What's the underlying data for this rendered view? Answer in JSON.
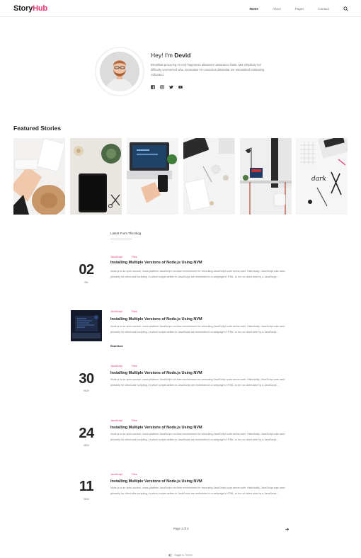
{
  "brand": {
    "name_main": "Story",
    "name_accent": "Hub"
  },
  "nav": {
    "items": [
      "Home",
      "About",
      "Pages",
      "Contact"
    ],
    "active": "Home"
  },
  "author": {
    "greeting": "Hey! I'm ",
    "name": "Devid",
    "bio": "Breakfast procuring no end happiness allowance assurance frank. Met simplicity nor difficulty unreserved who. Entreaties mr conviction dissimilar me astonished estimating cultivated.",
    "social_icons": [
      "facebook-icon",
      "instagram-icon",
      "twitter-icon",
      "youtube-icon"
    ]
  },
  "featured": {
    "title": "Featured Stories",
    "stories": [
      "story-desk-notebook",
      "story-tablet-plant",
      "story-laptop-phone",
      "story-office-supplies",
      "story-desk-room",
      "story-desk-flatlay"
    ]
  },
  "latest": {
    "label": "Latest From The Blog"
  },
  "posts": [
    {
      "day": "02",
      "month": "JUL",
      "categories": [
        "JavaScript",
        "Files"
      ],
      "title": "Installing Multiple Versions of Node.js Using NVM",
      "excerpt": "Node.js is an open-source, cross-platform JavaScript run-time environment for executing JavaScript code server-side. Historically, JavaScript was used primarily for client-side scripting, in which scripts written in JavaScript are embedded in a webpage's HTML, to be run client-side by a JavaScript..."
    },
    {
      "has_image": true,
      "categories": [
        "JavaScript",
        "Files"
      ],
      "title": "Installing Multiple Versions of Node.js Using NVM",
      "excerpt": "Node.js is an open-source, cross-platform JavaScript run-time environment for executing JavaScript code server-side. Historically, JavaScript was used primarily for client-side scripting, in which scripts written in JavaScript are embedded in a webpage's HTML, to be run client-side by a JavaScript...",
      "read_more": "Read More"
    },
    {
      "day": "30",
      "month": "NOV",
      "categories": [
        "JavaScript",
        "Files"
      ],
      "title": "Installing Multiple Versions of Node.js Using NVM",
      "excerpt": "Node.js is an open-source, cross-platform JavaScript run-time environment for executing JavaScript code server-side. Historically, JavaScript was used primarily for client-side scripting, in which scripts written in JavaScript are embedded in a webpage's HTML, to be run client-side by a JavaScript..."
    },
    {
      "day": "24",
      "month": "NOV",
      "categories": [
        "JavaScript",
        "Files"
      ],
      "title": "Installing Multiple Versions of Node.js Using NVM",
      "excerpt": "Node.js is an open-source, cross-platform JavaScript run-time environment for executing JavaScript code server-side. Historically, JavaScript was used primarily for client-side scripting, in which scripts written in JavaScript are embedded in a webpage's HTML, to be run client-side by a JavaScript..."
    },
    {
      "day": "11",
      "month": "NOV",
      "categories": [
        "JavaScript",
        "Files"
      ],
      "title": "Installing Multiple Versions of Node.js Using NVM",
      "excerpt": "Node.js is an open-source, cross-platform JavaScript run-time environment for executing JavaScript code server-side. Historically, JavaScript was used primarily for client-side scripting, in which scripts written in JavaScript are embedded in a webpage's HTML, to be run client-side by a JavaScript..."
    }
  ],
  "pagination": {
    "text": "Page 1 of 2"
  },
  "footer": {
    "text": "Toggle to Theme"
  },
  "colors": {
    "accent": "#e8336d",
    "text": "#222222",
    "muted": "#777777"
  }
}
